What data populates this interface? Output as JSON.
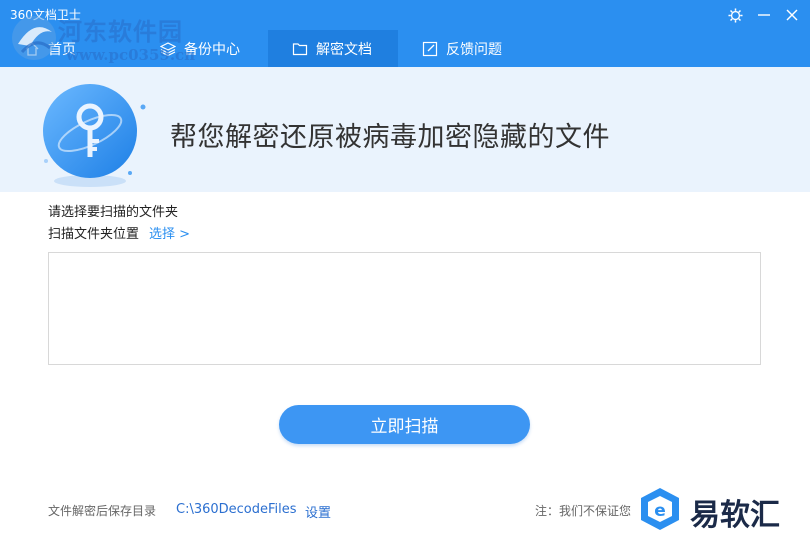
{
  "app": {
    "title": "360文档卫士"
  },
  "window_controls": [
    {
      "name": "settings-icon"
    },
    {
      "name": "minimize-icon"
    },
    {
      "name": "close-icon"
    }
  ],
  "nav": {
    "tabs": [
      {
        "label": "首页",
        "icon": "home-icon",
        "active": false
      },
      {
        "label": "备份中心",
        "icon": "layers-icon",
        "active": false
      },
      {
        "label": "解密文档",
        "icon": "folder-icon",
        "active": true
      },
      {
        "label": "反馈问题",
        "icon": "edit-icon",
        "active": false
      }
    ]
  },
  "watermark": {
    "text": "河东软件园",
    "url": "www.pc0359.cn"
  },
  "hero": {
    "icon": "key-icon",
    "headline": "帮您解密还原被病毒加密隐藏的文件"
  },
  "scan_section": {
    "prompt": "请选择要扫描的文件夹",
    "folder_label": "扫描文件夹位置",
    "select_link": "选择 >",
    "scan_button": "立即扫描"
  },
  "footer": {
    "save_label": "文件解密后保存目录",
    "save_path": "C:\\360DecodeFiles",
    "settings_link": "设置",
    "note": "注：我们不保证您"
  },
  "brand": {
    "text": "易软汇",
    "icon": "yiruanhui-logo"
  },
  "colors": {
    "primary": "#2b8ff0",
    "active_tab": "#1f7fe0",
    "hero_bg": "#eaf3fd",
    "button": "#3d96f3",
    "link": "#2b6fd0"
  }
}
